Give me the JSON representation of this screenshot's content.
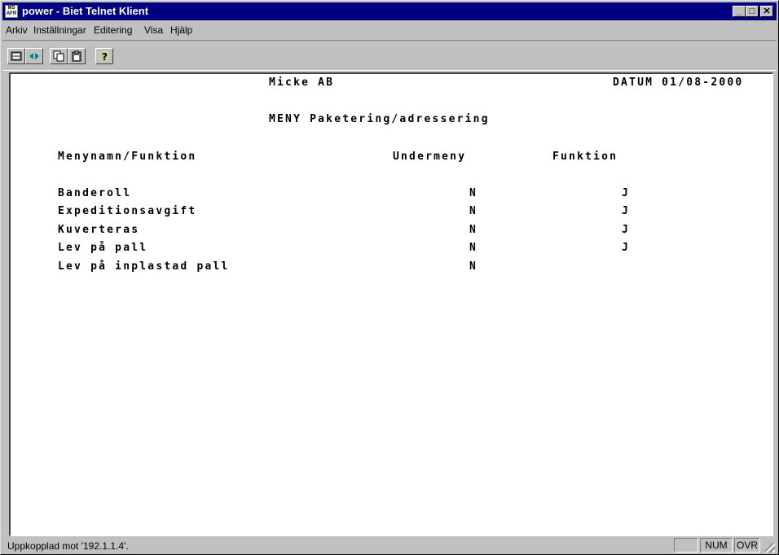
{
  "window": {
    "title": "power - Biet Telnet Klient",
    "app_icon_text": "MS AFR"
  },
  "titlebar_buttons": {
    "minimize": "_",
    "maximize": "□",
    "close": "✕"
  },
  "menu": {
    "items": [
      {
        "label": "Arkiv"
      },
      {
        "label": "Inställningar"
      },
      {
        "label": "Editering"
      },
      {
        "label": "Visa"
      },
      {
        "label": "Hjälp"
      }
    ]
  },
  "toolbar": {
    "buttons": [
      {
        "icon": "connect-icon"
      },
      {
        "icon": "disconnect-icon"
      },
      {
        "icon": "copy-icon"
      },
      {
        "icon": "paste-icon"
      },
      {
        "icon": "help-icon"
      }
    ]
  },
  "terminal": {
    "company": "Micke AB",
    "date": "DATUM 01/08-2000",
    "menu_title": "MENY Paketering/adressering",
    "headers": {
      "name": "Menynamn/Funktion",
      "submenu": "Undermeny",
      "function": "Funktion"
    },
    "rows": [
      {
        "name": "Banderoll",
        "submenu": "N",
        "function": "J"
      },
      {
        "name": "Expeditionsavgift",
        "submenu": "N",
        "function": "J"
      },
      {
        "name": "Kuverteras",
        "submenu": "N",
        "function": "J"
      },
      {
        "name": "Lev på pall",
        "submenu": "N",
        "function": "J"
      },
      {
        "name": "Lev på inplastad pall",
        "submenu": "N",
        "function": ""
      }
    ]
  },
  "status": {
    "text": "Uppkopplad mot '192.1.1.4'.",
    "num": "NUM",
    "ovr": "OVR"
  }
}
